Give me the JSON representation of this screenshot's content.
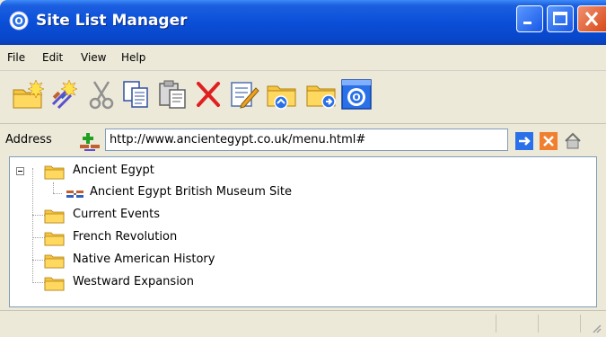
{
  "window": {
    "title": "Site List Manager"
  },
  "menu": [
    "File",
    "Edit",
    "View",
    "Help"
  ],
  "toolbar": {
    "buttons": [
      "new-folder",
      "new-site",
      "cut",
      "copy",
      "paste",
      "delete",
      "edit-properties",
      "folder-up",
      "folder-back",
      "about"
    ]
  },
  "address": {
    "label": "Address",
    "value": "http://www.ancientegypt.co.uk/menu.html#"
  },
  "tree": {
    "items": [
      {
        "label": "Ancient Egypt",
        "type": "folder",
        "expanded": true,
        "level": 0
      },
      {
        "label": "Ancient Egypt British Museum Site",
        "type": "link",
        "level": 1
      },
      {
        "label": "Current Events",
        "type": "folder",
        "level": 0
      },
      {
        "label": "French Revolution",
        "type": "folder",
        "level": 0
      },
      {
        "label": "Native American History",
        "type": "folder",
        "level": 0
      },
      {
        "label": "Westward Expansion",
        "type": "folder",
        "level": 0
      }
    ]
  },
  "colors": {
    "titlebar": "#0a4fd8",
    "window_bg": "#ece9d8",
    "folder": "#f5c542",
    "delete": "#e02020",
    "close": "#d84a1a"
  }
}
